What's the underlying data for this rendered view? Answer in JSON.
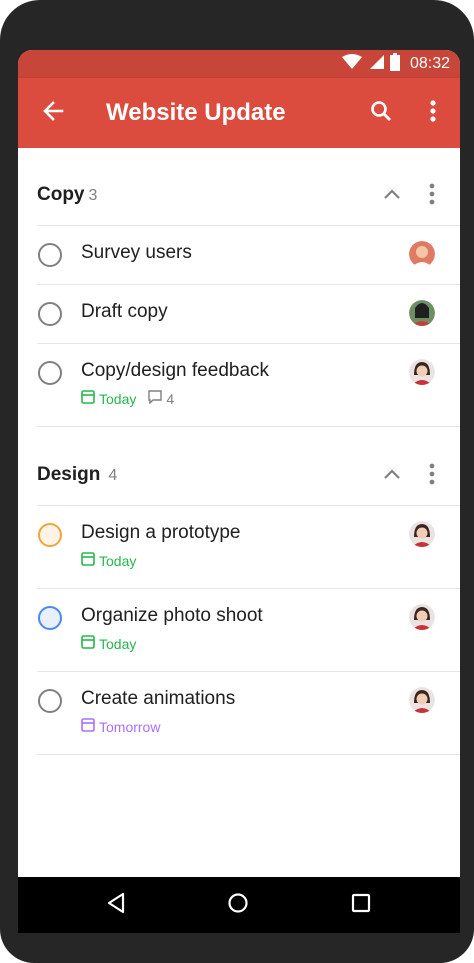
{
  "status_bar": {
    "time": "08:32"
  },
  "app_bar": {
    "title": "Website Update"
  },
  "sections": [
    {
      "name": "Copy",
      "count": "3",
      "tasks": [
        {
          "name": "Survey users"
        },
        {
          "name": "Draft copy"
        },
        {
          "name": "Copy/design feedback",
          "date": "Today",
          "comments": "4"
        }
      ]
    },
    {
      "name": "Design",
      "count": "4",
      "tasks": [
        {
          "name": "Design a prototype",
          "date": "Today"
        },
        {
          "name": "Organize photo shoot",
          "date": "Today"
        },
        {
          "name": "Create animations",
          "date": "Tomorrow"
        }
      ]
    }
  ],
  "colors": {
    "app_bar": "#db4c3f",
    "status_bar": "#c8453a",
    "today": "#25b84c",
    "tomorrow": "#a970ff",
    "priority_orange": "#f0a43a",
    "priority_blue": "#4a89f0"
  },
  "icons": [
    "back-arrow-icon",
    "search-icon",
    "more-vert-icon",
    "chevron-up-icon",
    "calendar-icon",
    "comment-icon",
    "nav-back-icon",
    "nav-home-icon",
    "nav-recents-icon",
    "wifi-icon",
    "signal-icon",
    "battery-icon"
  ]
}
